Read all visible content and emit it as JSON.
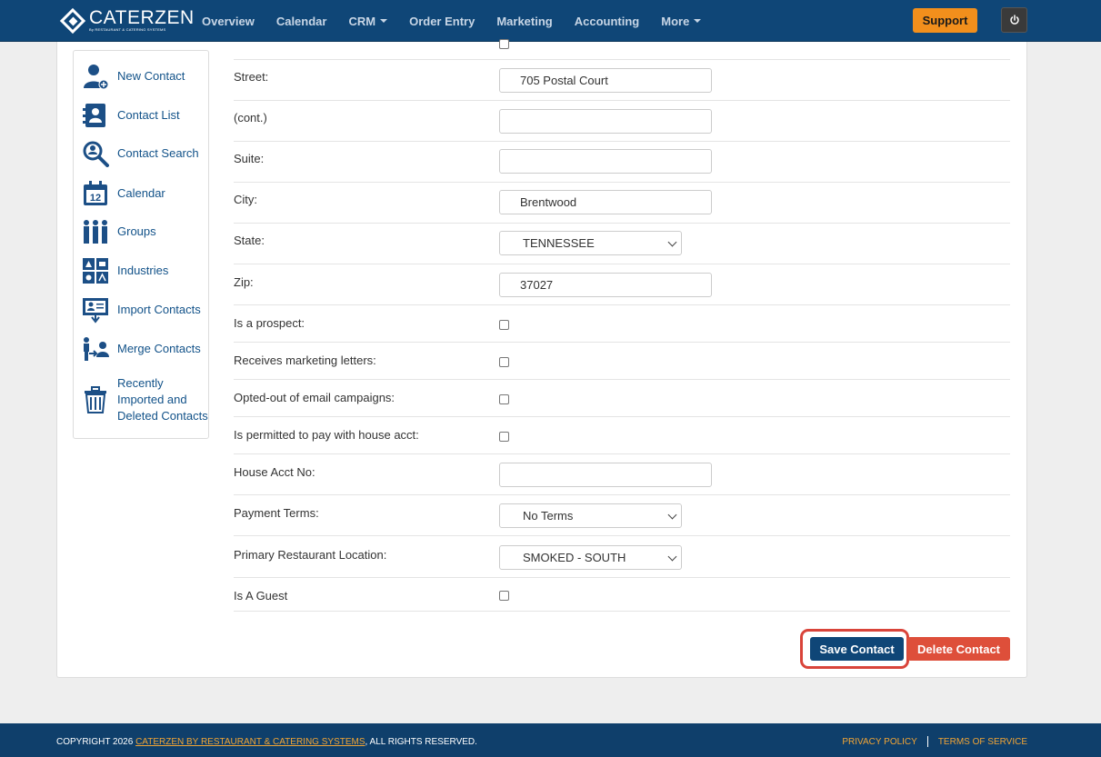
{
  "app": {
    "logo_name": "CATERZEN",
    "logo_sub": "By RESTAURANT & CATERING SYSTEMS"
  },
  "nav": {
    "items": [
      {
        "label": "Overview"
      },
      {
        "label": "Calendar"
      },
      {
        "label": "CRM",
        "dropdown": true
      },
      {
        "label": "Order Entry"
      },
      {
        "label": "Marketing"
      },
      {
        "label": "Accounting"
      },
      {
        "label": "More",
        "dropdown": true
      }
    ],
    "support_label": "Support",
    "power_icon": "power-icon"
  },
  "sidebar": {
    "items": [
      {
        "label": "New Contact",
        "icon": "add-person-icon"
      },
      {
        "label": "Contact List",
        "icon": "contact-book-icon"
      },
      {
        "label": "Contact Search",
        "icon": "search-person-icon"
      },
      {
        "label": "Calendar",
        "icon": "calendar-icon"
      },
      {
        "label": "Groups",
        "icon": "group-icon"
      },
      {
        "label": "Industries",
        "icon": "industries-icon"
      },
      {
        "label": "Import Contacts",
        "icon": "import-icon"
      },
      {
        "label": "Merge Contacts",
        "icon": "merge-icon"
      },
      {
        "label": "Recently Imported and Deleted Contacts",
        "icon": "trash-icon"
      }
    ]
  },
  "form": {
    "street_label": "Street:",
    "street_value": "705 Postal Court",
    "cont_label": "(cont.)",
    "cont_value": "",
    "suite_label": "Suite:",
    "suite_value": "",
    "city_label": "City:",
    "city_value": "Brentwood",
    "state_label": "State:",
    "state_value": "TENNESSEE",
    "zip_label": "Zip:",
    "zip_value": "37027",
    "prospect_label": "Is a prospect:",
    "marketing_label": "Receives marketing letters:",
    "optout_label": "Opted-out of email campaigns:",
    "house_pay_label": "Is permitted to pay with house acct:",
    "house_acct_label": "House Acct No:",
    "house_acct_value": "",
    "payment_terms_label": "Payment Terms:",
    "payment_terms_value": "No Terms",
    "location_label": "Primary Restaurant Location:",
    "location_value": "SMOKED - SOUTH",
    "guest_label": "Is A Guest",
    "save_label": "Save Contact",
    "delete_label": "Delete Contact"
  },
  "footer": {
    "copyright_prefix": "COPYRIGHT 2026",
    "copyright_link": "CATERZEN BY RESTAURANT & CATERING SYSTEMS",
    "copyright_suffix": ", ALL RIGHTS RESERVED.",
    "privacy_label": "PRIVACY POLICY",
    "terms_label": "TERMS OF SERVICE"
  },
  "colors": {
    "nav_bg": "#0f4677",
    "accent_orange": "#f28f1c",
    "link_blue": "#125289",
    "delete_red": "#de4f3a",
    "highlight_outline": "#d9443a"
  }
}
